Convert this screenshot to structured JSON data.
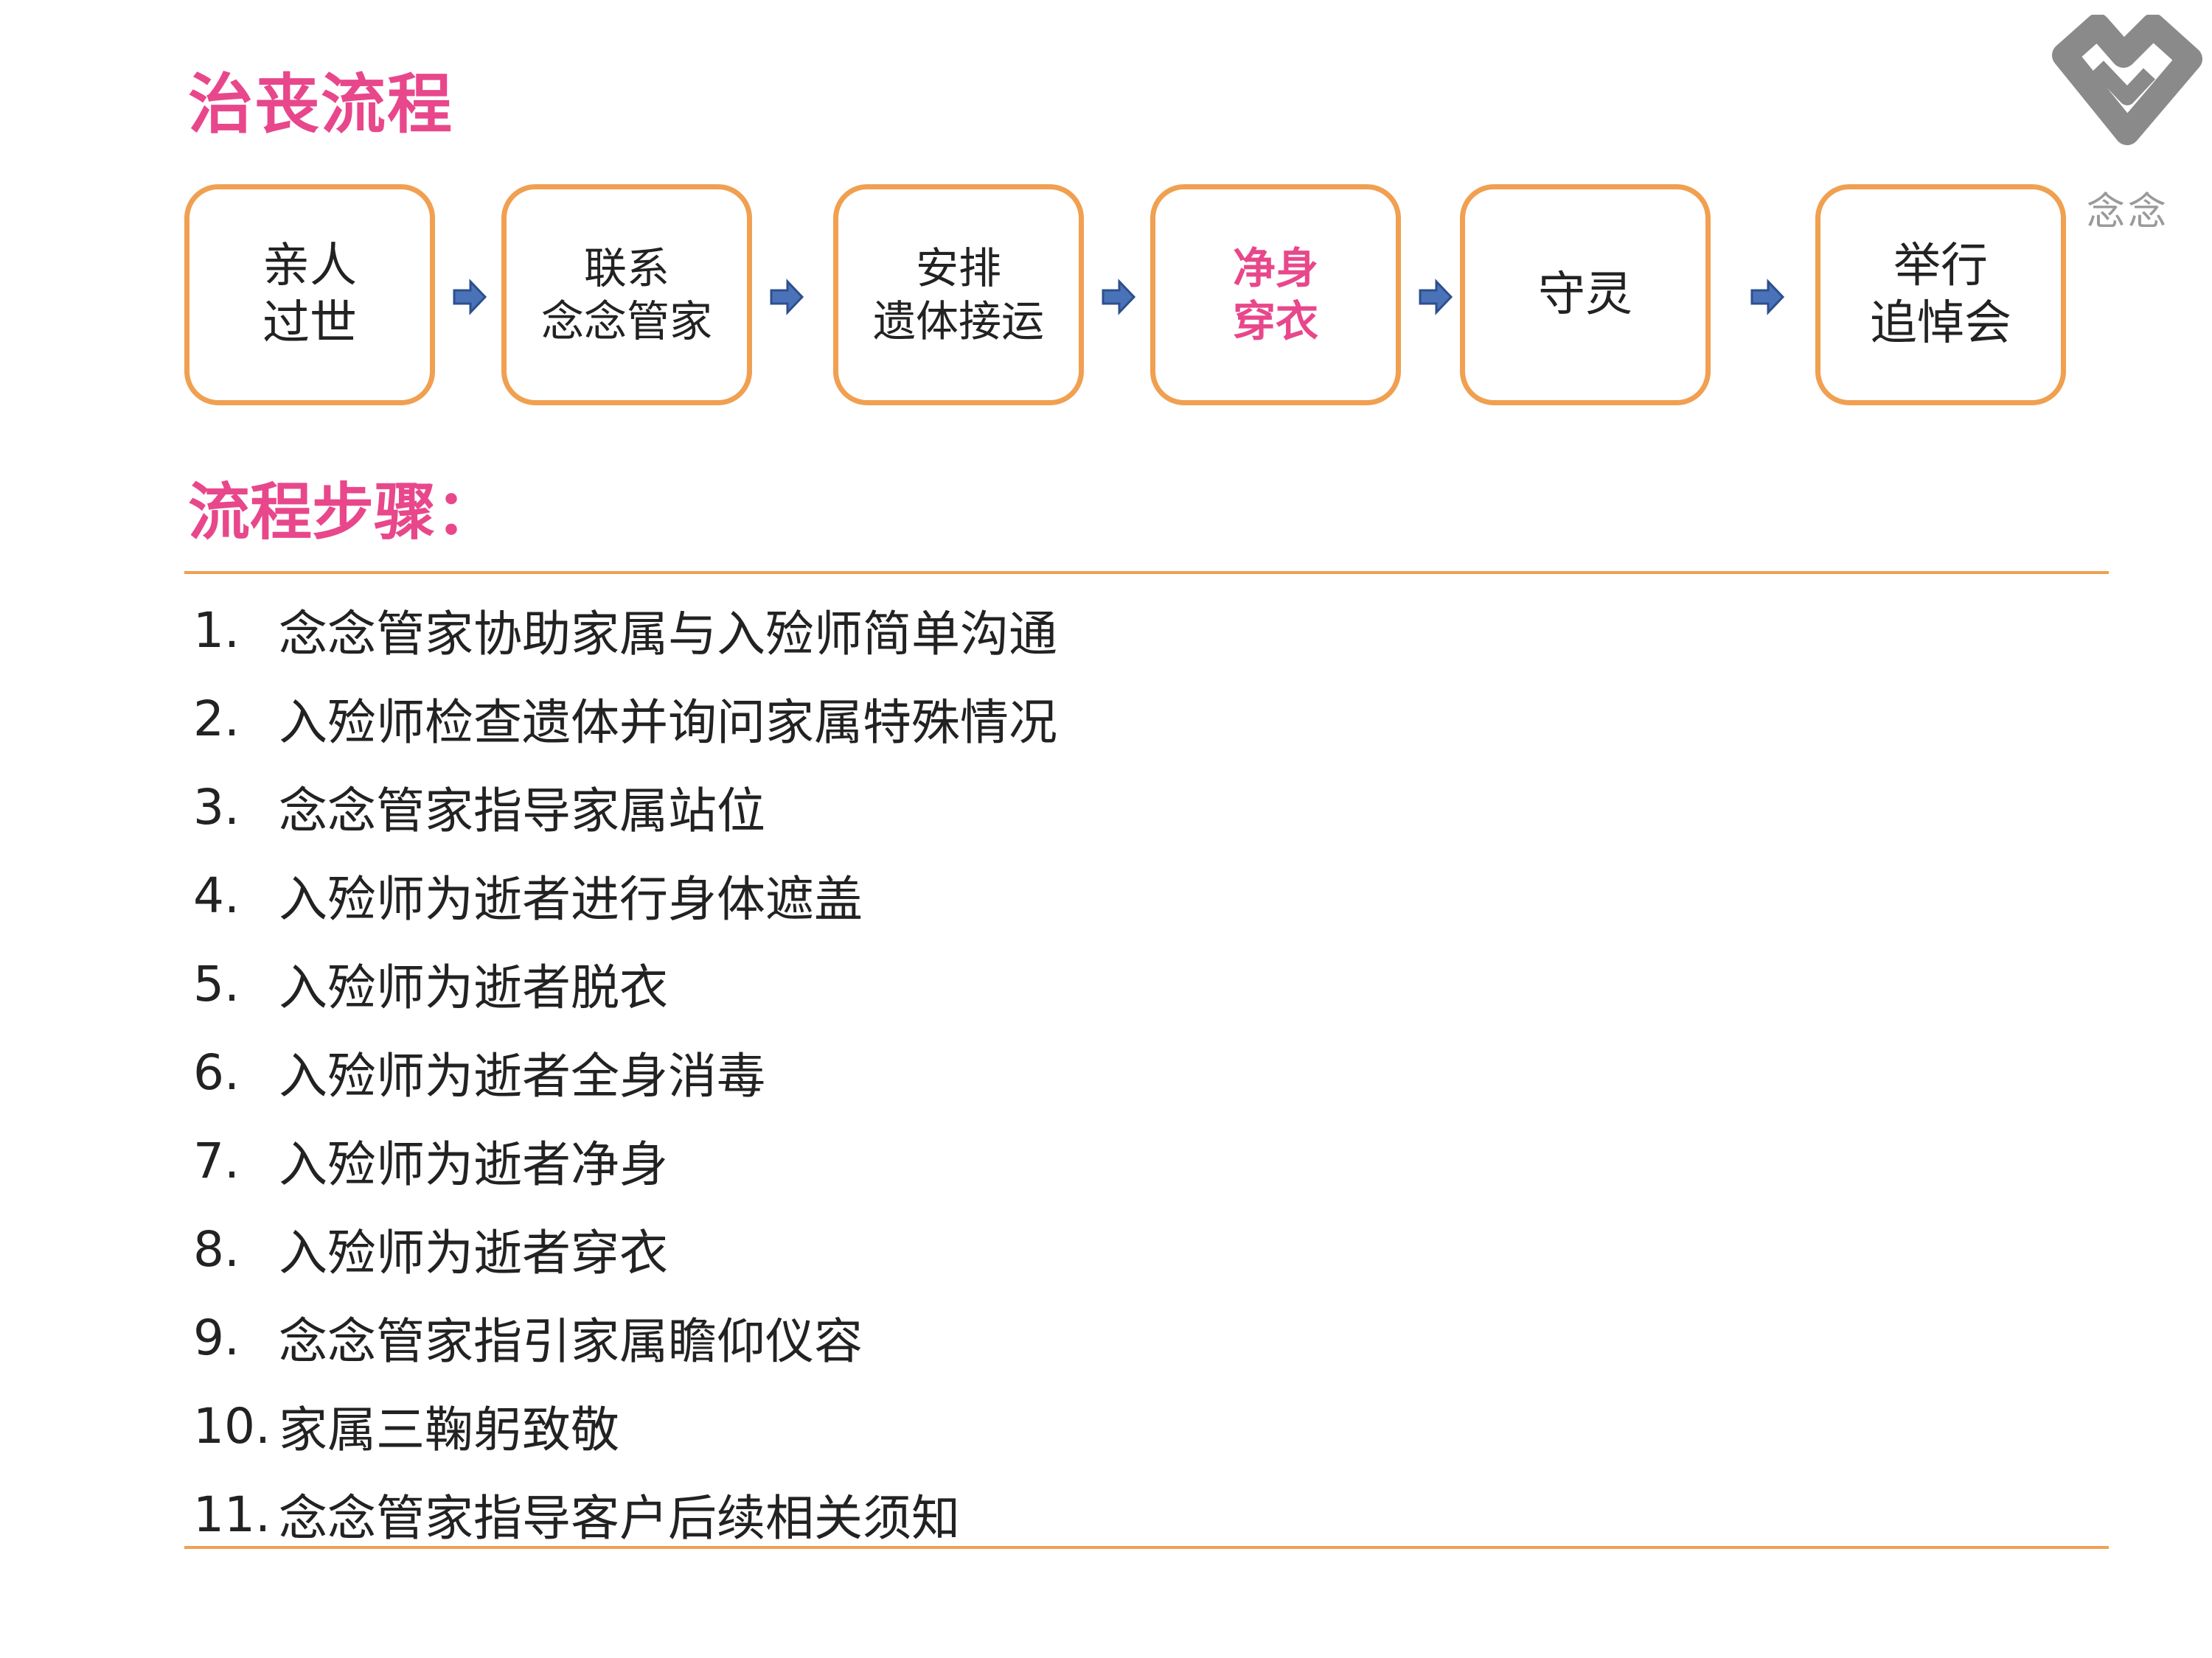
{
  "header": {
    "title": "治丧流程",
    "logo_text": "念念"
  },
  "flow": {
    "steps": [
      {
        "label": "亲人\n过世"
      },
      {
        "label": "联系\n念念管家"
      },
      {
        "label": "安排\n遗体接运"
      },
      {
        "label": "净身\n穿衣",
        "active": true
      },
      {
        "label": "守灵"
      },
      {
        "label": "举行\n追悼会"
      }
    ]
  },
  "procedure": {
    "title": "流程步骤：",
    "items": [
      {
        "num": "1.",
        "text": "念念管家协助家属与入殓师简单沟通"
      },
      {
        "num": "2.",
        "text": "入殓师检查遗体并询问家属特殊情况"
      },
      {
        "num": "3.",
        "text": "念念管家指导家属站位"
      },
      {
        "num": "4.",
        "text": "入殓师为逝者进行身体遮盖"
      },
      {
        "num": "5.",
        "text": "入殓师为逝者脱衣"
      },
      {
        "num": "6.",
        "text": "入殓师为逝者全身消毒"
      },
      {
        "num": "7.",
        "text": "入殓师为逝者净身"
      },
      {
        "num": "8.",
        "text": "入殓师为逝者穿衣"
      },
      {
        "num": "9.",
        "text": "念念管家指引家属瞻仰仪容"
      },
      {
        "num": "10.",
        "text": "家属三鞠躬致敬"
      },
      {
        "num": "11.",
        "text": "念念管家指导客户后续相关须知"
      }
    ]
  },
  "colors": {
    "accent_pink": "#e8478b",
    "box_border_orange": "#f0a050",
    "arrow_blue": "#4a72b8",
    "logo_gray": "#8a8a8a"
  }
}
